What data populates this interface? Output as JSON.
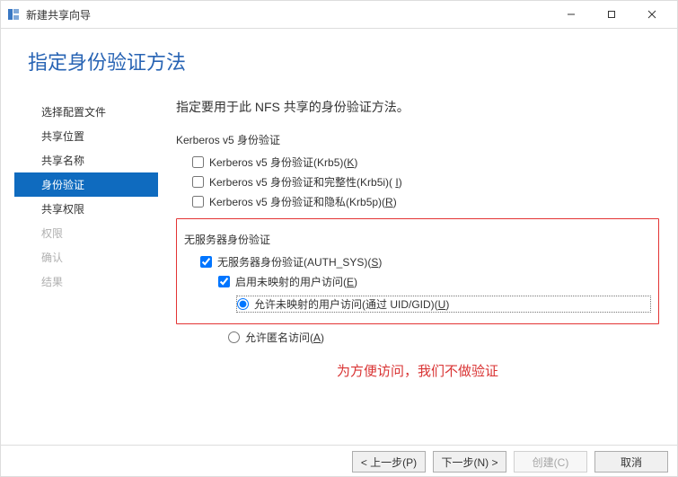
{
  "titlebar": {
    "title": "新建共享向导"
  },
  "header": {
    "page_title": "指定身份验证方法"
  },
  "sidebar": {
    "items": [
      {
        "label": "选择配置文件",
        "state": "normal"
      },
      {
        "label": "共享位置",
        "state": "normal"
      },
      {
        "label": "共享名称",
        "state": "normal"
      },
      {
        "label": "身份验证",
        "state": "active"
      },
      {
        "label": "共享权限",
        "state": "normal"
      },
      {
        "label": "权限",
        "state": "disabled"
      },
      {
        "label": "确认",
        "state": "disabled"
      },
      {
        "label": "结果",
        "state": "disabled"
      }
    ]
  },
  "main": {
    "instruction": "指定要用于此 NFS 共享的身份验证方法。",
    "group_kerberos": "Kerberos v5 身份验证",
    "cb_krb5": "Kerberos v5 身份验证(Krb5)(",
    "cb_krb5_key": "K",
    "cb_krb5_close": ")",
    "cb_krb5i": "Kerberos v5 身份验证和完整性(Krb5i)( ",
    "cb_krb5i_key": "I",
    "cb_krb5i_close": ")",
    "cb_krb5p": "Kerberos v5 身份验证和隐私(Krb5p)(",
    "cb_krb5p_key": "R",
    "cb_krb5p_close": ")",
    "group_noauth": "无服务器身份验证",
    "cb_authsys": "无服务器身份验证(AUTH_SYS)(",
    "cb_authsys_key": "S",
    "cb_authsys_close": ")",
    "cb_unmapped": "启用未映射的用户访问(",
    "cb_unmapped_key": "E",
    "cb_unmapped_close": ")",
    "rb_uidgid": "允许未映射的用户访问(通过 UID/GID)(",
    "rb_uidgid_key": "U",
    "rb_uidgid_close": ")",
    "rb_anon": "允许匿名访问(",
    "rb_anon_key": "A",
    "rb_anon_close": ")",
    "annotation": "为方便访问，我们不做验证"
  },
  "footer": {
    "prev": "< 上一步(P)",
    "next": "下一步(N) >",
    "create": "创建(C)",
    "cancel": "取消"
  }
}
